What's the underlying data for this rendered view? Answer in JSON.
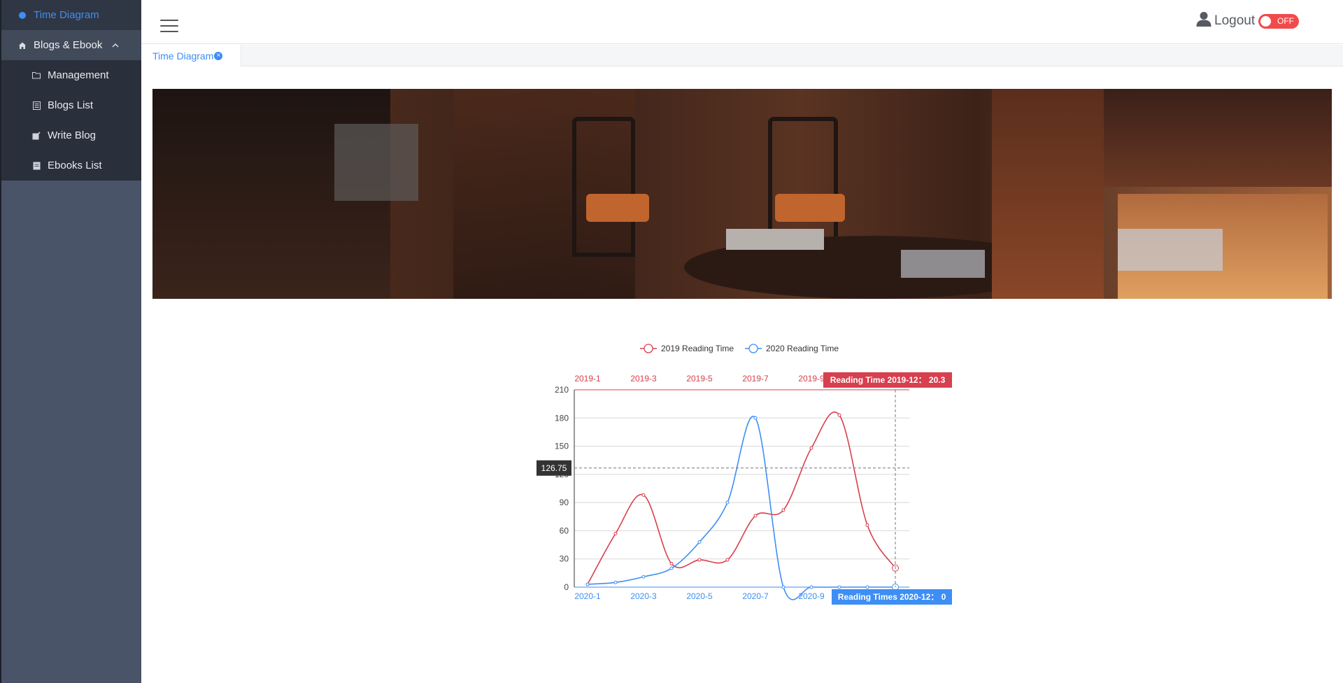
{
  "sidebar": {
    "active_item": {
      "label": "Time Diagram",
      "icon": "dot-icon"
    },
    "group": {
      "label": "Blogs & Ebook",
      "icon": "home-icon",
      "expanded": true
    },
    "items": [
      {
        "label": "Management",
        "icon": "folder-icon"
      },
      {
        "label": "Blogs List",
        "icon": "list-icon"
      },
      {
        "label": "Write Blog",
        "icon": "edit-icon"
      },
      {
        "label": "Ebooks List",
        "icon": "book-icon"
      }
    ]
  },
  "header": {
    "logout_label": "Logout",
    "toggle_label": "OFF"
  },
  "tabs": [
    {
      "label": "Time Diagram",
      "active": true
    }
  ],
  "colors": {
    "accent": "#3d8ef5",
    "series_2019": "#d6404f",
    "series_2020": "#3d8ef5",
    "sidebar": "#4a5468",
    "toggle_off": "#f24a4a"
  },
  "chart_data": {
    "type": "line",
    "legend": [
      "2019 Reading Time",
      "2020 Reading Time"
    ],
    "legend_position": "top-center",
    "y_axis": {
      "min": 0,
      "max": 210,
      "ticks": [
        0,
        30,
        60,
        90,
        120,
        150,
        180,
        210
      ],
      "grid": true
    },
    "x_axis_top": {
      "labels": [
        "2019-1",
        "2019-3",
        "2019-5",
        "2019-7",
        "2019-9"
      ]
    },
    "x_axis_bottom": {
      "labels": [
        "2020-1",
        "2020-3",
        "2020-5",
        "2020-7",
        "2020-9"
      ]
    },
    "series": [
      {
        "name": "2019 Reading Time",
        "values": [
          3,
          57,
          98,
          25,
          29,
          29,
          76,
          82,
          148,
          183,
          66,
          20.3
        ]
      },
      {
        "name": "2020 Reading Time",
        "values": [
          3,
          5,
          11,
          20,
          48,
          90,
          180,
          0,
          0,
          0,
          0,
          0
        ]
      }
    ],
    "pointer": {
      "y_value_label": "126.75",
      "top_tooltip": "Reading Time  2019-12： 20.3",
      "bottom_tooltip": "Reading Times  2020-12： 0"
    }
  }
}
